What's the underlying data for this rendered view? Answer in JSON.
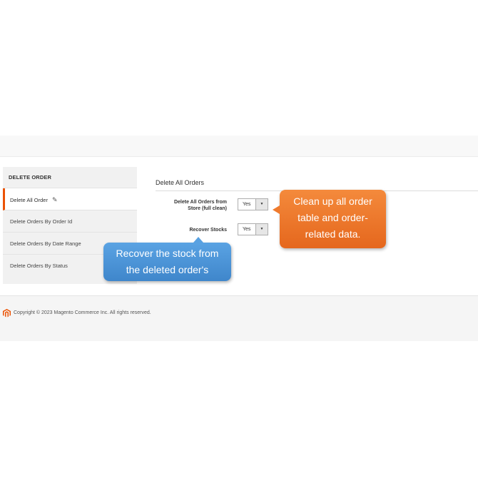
{
  "sidebar": {
    "title": "DELETE ORDER",
    "items": [
      {
        "label": "Delete All Order",
        "active": true
      },
      {
        "label": "Delete Orders By Order Id"
      },
      {
        "label": "Delete Orders By Date Range"
      },
      {
        "label": "Delete Orders By Status"
      }
    ]
  },
  "main": {
    "section_title": "Delete All Orders",
    "fields": [
      {
        "label_line1": "Delete All Orders from",
        "label_line2": "Store (full clean)",
        "value": "Yes"
      },
      {
        "label": "Recover Stocks",
        "value": "Yes"
      }
    ]
  },
  "callouts": {
    "orange": {
      "line1": "Clean up all order",
      "line2": "table and order-",
      "line3": "related data.",
      "color": "#ef7a2d"
    },
    "blue": {
      "line1": "Recover the stock from",
      "line2": "the deleted order's",
      "color": "#4a93d6"
    }
  },
  "footer": {
    "copyright": "Copyright © 2023 Magento Commerce Inc. All rights reserved.",
    "logo_icon": "magento-logo-icon",
    "accent": "#eb5202"
  }
}
